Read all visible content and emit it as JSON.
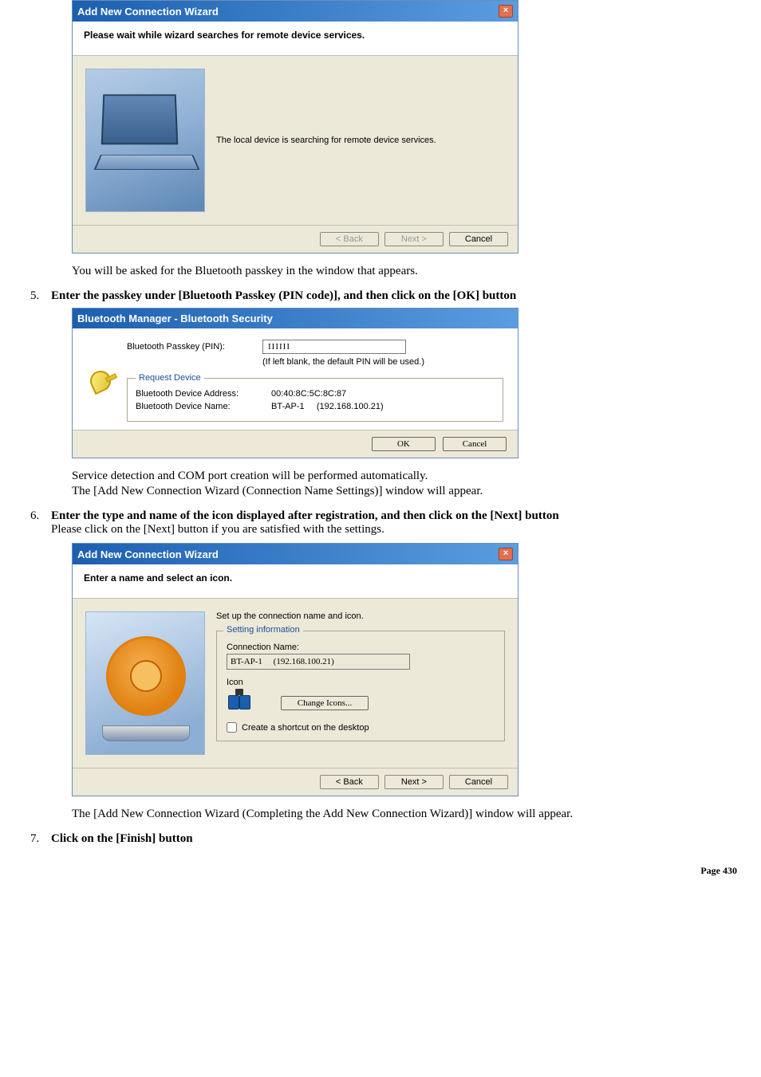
{
  "dialog_search": {
    "title": "Add New Connection Wizard",
    "header": "Please wait while wizard searches for remote device services.",
    "message": "The local device is searching for remote device services.",
    "buttons": {
      "back": "< Back",
      "next": "Next >",
      "cancel": "Cancel"
    }
  },
  "text_after_search": "You will be asked for the Bluetooth passkey in the window that appears.",
  "step5": {
    "num": "5.",
    "text": "Enter the passkey under [Bluetooth Passkey (PIN code)], and then click on the [OK] button"
  },
  "security_dialog": {
    "title": "Bluetooth Manager - Bluetooth Security",
    "passkey_label": "Bluetooth Passkey (PIN):",
    "passkey_value": "IIIIII",
    "hint": "(If left blank, the default PIN will be used.)",
    "request_legend": "Request Device",
    "addr_label": "Bluetooth Device Address:",
    "addr_value": "00:40:8C:5C:8C:87",
    "name_label": "Bluetooth Device Name:",
    "name_value": "BT-AP-1     (192.168.100.21)",
    "ok": "OK",
    "cancel": "Cancel"
  },
  "text_after_security_1": "Service detection and COM port creation will be performed automatically.",
  "text_after_security_2": "The [Add New Connection Wizard (Connection Name Settings)] window will appear.",
  "step6": {
    "num": "6.",
    "line1": "Enter the type and name of the icon displayed after registration, and then click on the [Next] button",
    "line2": "Please click on the [Next] button if you are satisfied with the settings."
  },
  "dialog_name": {
    "title": "Add New Connection Wizard",
    "header": "Enter a name and select an icon.",
    "instr": "Set up the connection name and icon.",
    "legend": "Setting information",
    "conn_label": "Connection Name:",
    "conn_value": "BT-AP-1     (192.168.100.21)",
    "icon_label": "Icon",
    "change_icons": "Change Icons...",
    "shortcut": "Create a shortcut on the desktop",
    "buttons": {
      "back": "< Back",
      "next": "Next >",
      "cancel": "Cancel"
    }
  },
  "text_after_name": "The [Add New Connection Wizard (Completing the Add New Connection Wizard)] window will appear.",
  "step7": {
    "num": "7.",
    "text": "Click on the [Finish] button"
  },
  "page_num": "Page 430"
}
